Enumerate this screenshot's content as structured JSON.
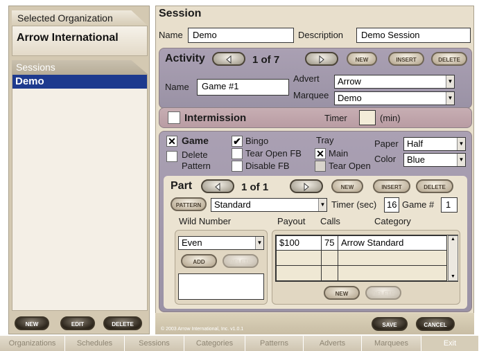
{
  "left": {
    "org_header": "Selected Organization",
    "org_name": "Arrow International",
    "sessions_header": "Sessions",
    "sessions": [
      "Demo"
    ],
    "buttons": {
      "new": "NEW",
      "edit": "EDIT",
      "delete": "DELETE"
    }
  },
  "session": {
    "title": "Session",
    "name_label": "Name",
    "name_value": "Demo",
    "description_label": "Description",
    "description_value": "Demo Session"
  },
  "activity": {
    "title": "Activity",
    "counter": "1 of 7",
    "buttons": {
      "new": "NEW",
      "insert": "INSERT",
      "delete": "DELETE"
    },
    "name_label": "Name",
    "name_value": "Game #1",
    "advert_label": "Advert",
    "advert_value": "Arrow",
    "marquee_label": "Marquee",
    "marquee_value": "Demo"
  },
  "intermission": {
    "label": "Intermission",
    "timer_label": "Timer",
    "timer_unit": "(min)"
  },
  "game": {
    "game_label": "Game",
    "game_checked": "✕",
    "delete_pattern_label": "Delete Pattern",
    "bingo_label": "Bingo",
    "bingo_checked": "✔",
    "tear_open_fb_label": "Tear Open FB",
    "disable_fb_label": "Disable FB",
    "tray_label": "Tray",
    "main_label": "Main",
    "main_checked": "✕",
    "tear_open_label": "Tear Open",
    "paper_label": "Paper",
    "paper_value": "Half",
    "color_label": "Color",
    "color_value": "Blue"
  },
  "part": {
    "title": "Part",
    "counter": "1 of 1",
    "buttons": {
      "new": "NEW",
      "insert": "INSERT",
      "delete": "DELETE"
    },
    "pattern_button": "PATTERN",
    "pattern_value": "Standard",
    "timer_label": "Timer (sec)",
    "timer_value": "16",
    "game_num_label": "Game #",
    "game_num_value": "1",
    "wild_label": "Wild Number",
    "wild_value": "Even",
    "wild_add": "ADD",
    "wild_delete": "DELETE",
    "payout_header": "Payout",
    "calls_header": "Calls",
    "category_header": "Category",
    "rows": [
      {
        "payout": "$100",
        "calls": "75",
        "category": "Arrow Standard"
      },
      {
        "payout": "",
        "calls": "",
        "category": ""
      },
      {
        "payout": "",
        "calls": "",
        "category": ""
      }
    ],
    "grid_new": "NEW",
    "grid_delete": "DELETE"
  },
  "footer": {
    "copyright": "© 2003 Arrow International, Inc. v1.0.1",
    "save": "SAVE",
    "cancel": "CANCEL"
  },
  "nav": [
    "Organizations",
    "Schedules",
    "Sessions",
    "Categories",
    "Patterns",
    "Adverts",
    "Marquees",
    "Exit"
  ]
}
